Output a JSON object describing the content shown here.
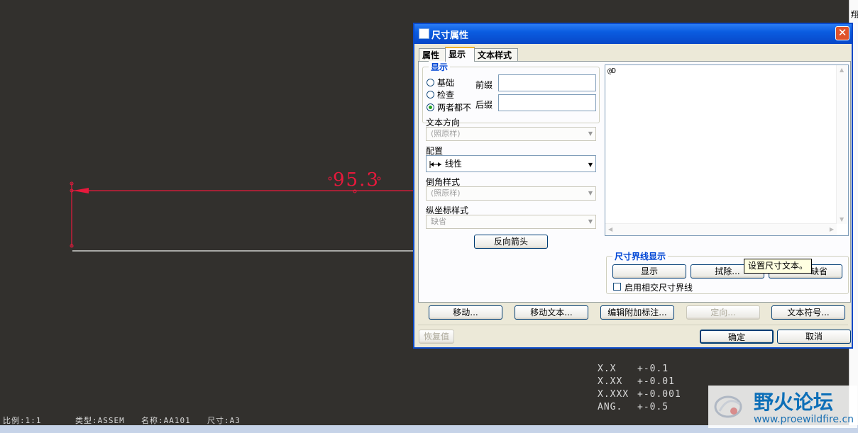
{
  "cad": {
    "dimension_value": "95.3",
    "status_bar": {
      "scale": "比例:1:1",
      "type": "类型:ASSEM",
      "name": "名称:AA101",
      "size": "尺寸:A3"
    },
    "tolerance_table": [
      {
        "format": "X.X",
        "value": "+-0.1"
      },
      {
        "format": "X.XX",
        "value": "+-0.01"
      },
      {
        "format": "X.XXX",
        "value": "+-0.001"
      },
      {
        "format": "ANG.",
        "value": "+-0.5"
      }
    ],
    "dimension_color": "#e8193c"
  },
  "right_edge": {
    "chars": [
      "翔",
      "I"
    ]
  },
  "watermark": {
    "title": "野火论坛",
    "url": "www.proewildfire.cn"
  },
  "dialog": {
    "title": "尺寸属性",
    "close_glyph": "✕",
    "tabs": [
      {
        "label": "属性"
      },
      {
        "label": "显示"
      },
      {
        "label": "文本样式"
      }
    ],
    "display_group": {
      "title": "显示",
      "radios": [
        "基础",
        "检查",
        "两者都不"
      ],
      "selected": "两者都不",
      "prefix_label": "前缀",
      "prefix_value": "",
      "suffix_label": "后缀",
      "suffix_value": ""
    },
    "text_direction": {
      "label": "文本方向",
      "value": "(照原样)"
    },
    "config": {
      "label": "配置",
      "value": "线性",
      "icon": "linear-dimension-icon"
    },
    "chamfer_style": {
      "label": "倒角样式",
      "value": "(照原样)"
    },
    "ordinate_style": {
      "label": "纵坐标样式",
      "value": "缺省"
    },
    "flip_arrows_button": "反向箭头",
    "text_value": "@D",
    "witness_group": {
      "title": "尺寸界线显示",
      "show_button": "显示",
      "erase_button": "拭除...",
      "default_button": "缺省",
      "checkbox_label": "启用相交尺寸界线"
    },
    "tooltip": "设置尺寸文本。",
    "bottom_buttons": {
      "move": "移动...",
      "move_text": "移动文本...",
      "edit_attach": "编辑附加标注...",
      "orient": "定向...",
      "text_symbol": "文本符号..."
    },
    "restore_button": "恢复值",
    "ok_button": "确定",
    "cancel_button": "取消"
  }
}
